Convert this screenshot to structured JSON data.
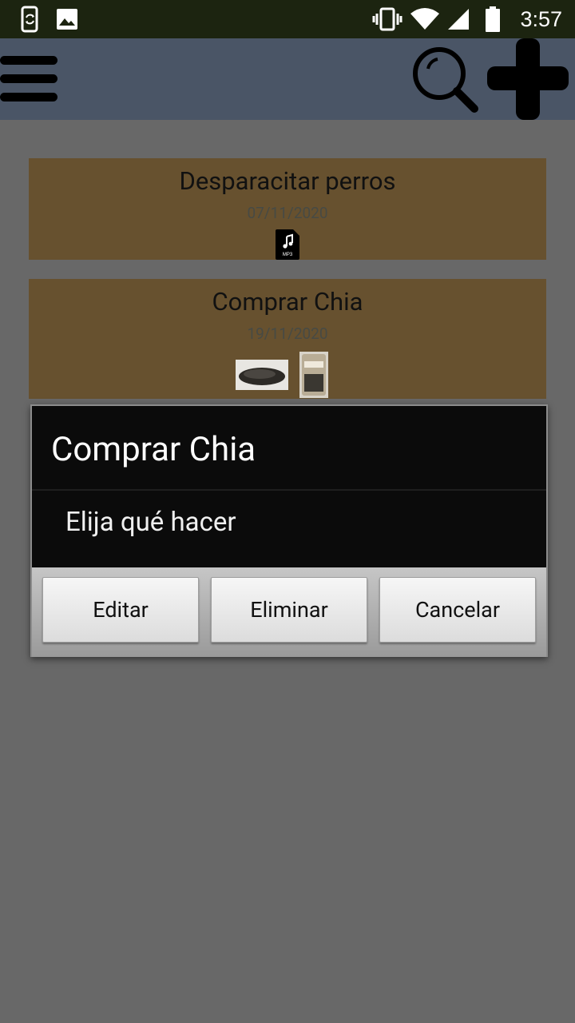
{
  "status_bar": {
    "time": "3:57",
    "left_icons": [
      "phone-sync-icon",
      "image-icon"
    ],
    "right_icons": [
      "vibrate-icon",
      "wifi-icon",
      "cellular-signal-icon",
      "battery-icon"
    ]
  },
  "app_bar": {
    "menu_icon": "hamburger-menu-icon",
    "search_icon": "search-icon",
    "add_icon": "plus-icon"
  },
  "tasks": [
    {
      "title": "Desparacitar perros",
      "date": "07/11/2020",
      "attachments": [
        "mp3-file-icon"
      ]
    },
    {
      "title": "Comprar Chia",
      "date": "19/11/2020",
      "attachments": [
        "chia-seeds-photo",
        "chia-package-photo"
      ]
    }
  ],
  "dialog": {
    "title": "Comprar Chia",
    "message": "Elija qué hacer",
    "buttons": {
      "edit": "Editar",
      "delete": "Eliminar",
      "cancel": "Cancelar"
    }
  },
  "colors": {
    "status_bar": "#1c2410",
    "app_bar": "#4a5566",
    "card": "#67512f",
    "dim_background": "#686868",
    "dialog": "#0b0b0b"
  }
}
